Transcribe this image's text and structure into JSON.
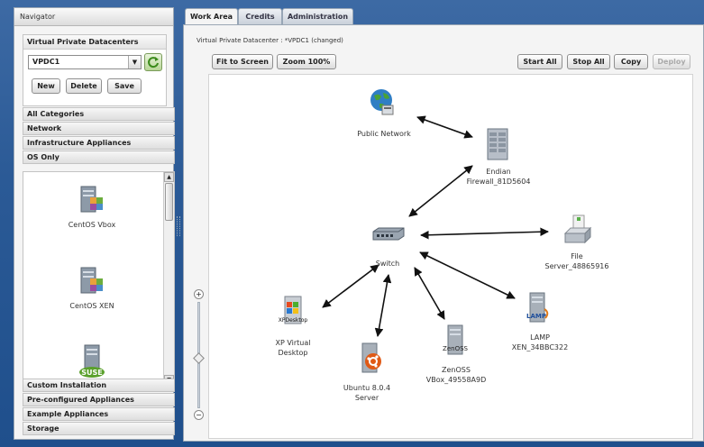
{
  "navigator": {
    "title": "Navigator",
    "vpdc_section_title": "Virtual Private Datacenters",
    "selected_vpdc": "VPDC1",
    "buttons": {
      "new": "New",
      "delete": "Delete",
      "save": "Save"
    },
    "categories_top": [
      "All Categories",
      "Network",
      "Infrastructure Appliances",
      "OS Only"
    ],
    "os_items": [
      "CentOS Vbox",
      "CentOS XEN"
    ],
    "os_partial_icon_text": "SUSE",
    "categories_bottom": [
      "Custom Installation",
      "Pre-configured Appliances",
      "Example Appliances",
      "Storage"
    ]
  },
  "tabs": [
    "Work Area",
    "Credits",
    "Administration"
  ],
  "work_area": {
    "title": "Virtual Private Datacenter : *VPDC1 (changed)",
    "toolbar": {
      "fit": "Fit to Screen",
      "zoom": "Zoom 100%",
      "start_all": "Start All",
      "stop_all": "Stop All",
      "copy": "Copy",
      "deploy": "Deploy"
    },
    "nodes": {
      "public_network": "Public Network",
      "firewall_1": "Endian",
      "firewall_2": "Firewall_81D5604",
      "switch": "Switch",
      "file_1": "File",
      "file_2": "Server_48865916",
      "xp_icon": "XPDesktop",
      "xp_1": "XP Virtual",
      "xp_2": "Desktop",
      "ubuntu_1": "Ubuntu 8.0.4",
      "ubuntu_2": "Server",
      "zenoss_icon": "ZenOSS",
      "zenoss_1": "ZenOSS",
      "zenoss_2": "VBox_49558A9D",
      "lamp_icon": "LAMP",
      "lamp_1": "LAMP",
      "lamp_2": "XEN_34BBC322"
    }
  },
  "colors": {
    "background": "#2b5a96",
    "panel": "#f4f4f4",
    "refresh_green": "#3a8a1a"
  }
}
